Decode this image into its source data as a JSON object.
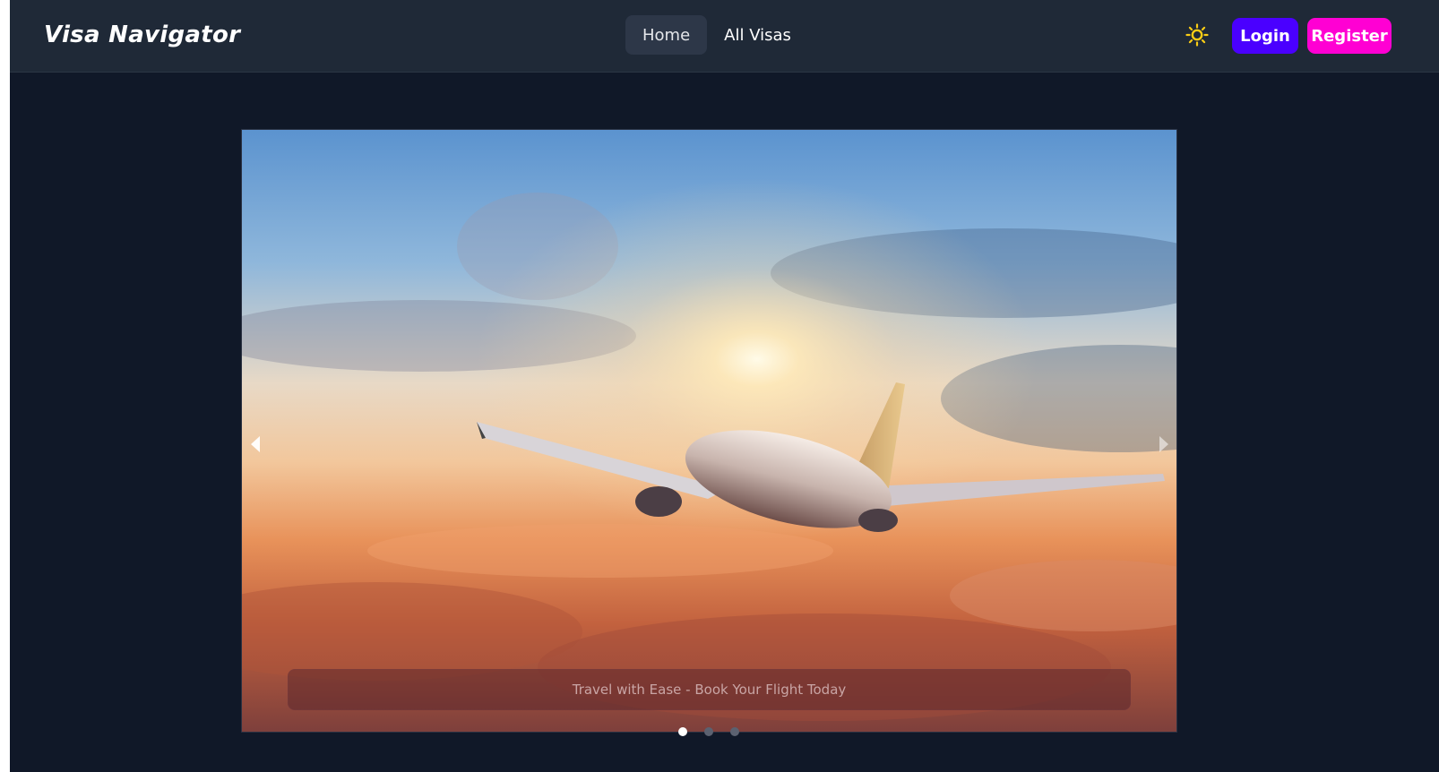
{
  "brand": {
    "name": "Visa Navigator"
  },
  "nav": {
    "links": [
      {
        "label": "Home",
        "active": true
      },
      {
        "label": "All Visas",
        "active": false
      }
    ]
  },
  "header_actions": {
    "theme_toggle_icon": "sun-icon",
    "login_label": "Login",
    "register_label": "Register"
  },
  "colors": {
    "login": "#4a00ff",
    "register": "#ff00d3",
    "theme_icon": "#facc15",
    "background": "#101828",
    "navbar": "#1f2937"
  },
  "carousel": {
    "caption": "Travel with Ease - Book Your Flight Today",
    "slide_count": 3,
    "active_slide": 1,
    "image": "airplane-sunset-photo"
  }
}
